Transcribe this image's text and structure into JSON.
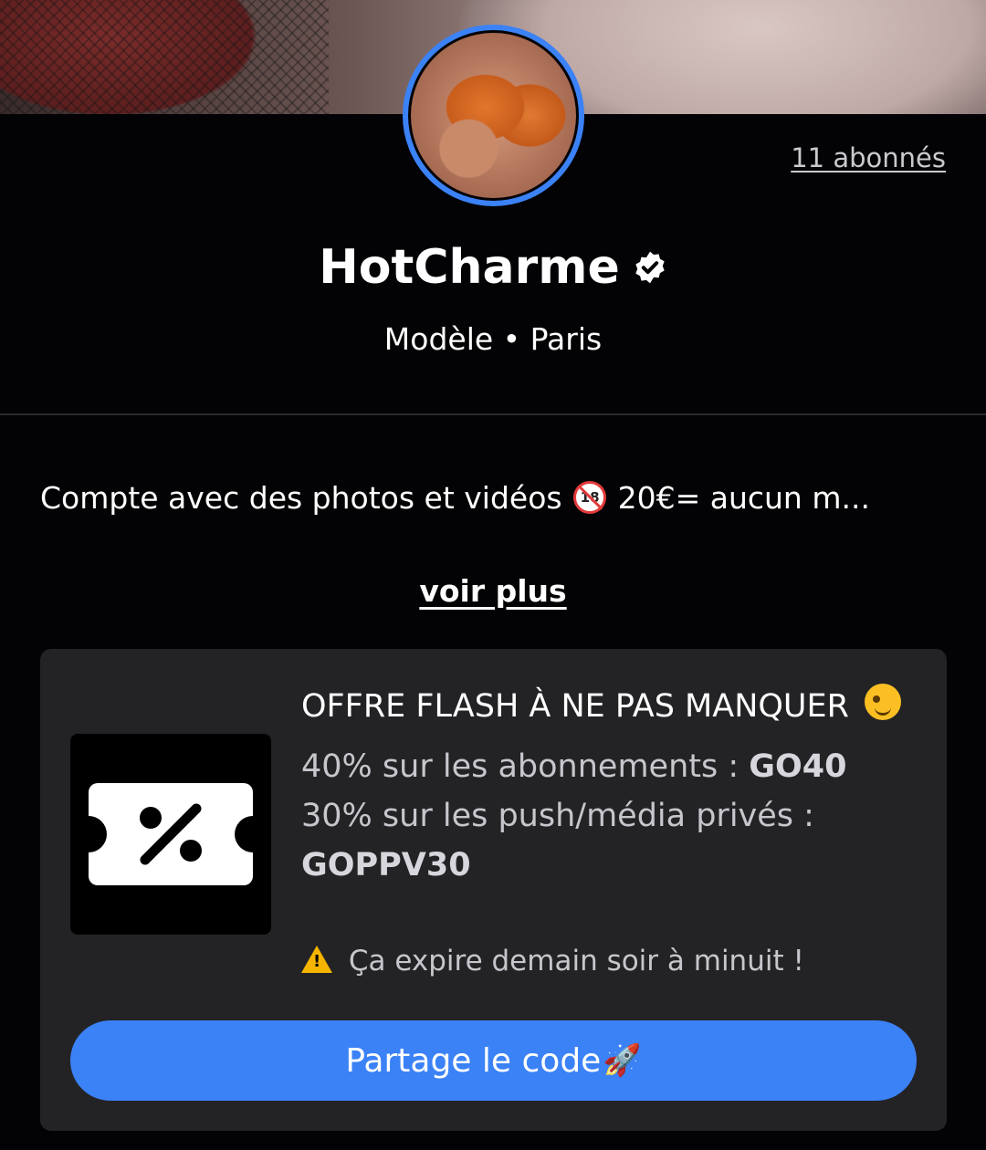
{
  "profile": {
    "followers_label": "11 abonnés",
    "name": "HotCharme",
    "subtitle": "Modèle • Paris",
    "bio_before": "Compte avec des photos et vidéos",
    "bio_after": "20€= aucun m...",
    "more_label": "voir plus"
  },
  "promo": {
    "title": "OFFRE FLASH À NE PAS MANQUER",
    "line1_text": "40% sur les abonnements : ",
    "line1_code": "GO40",
    "line2_text": "30% sur les push/média privés : ",
    "line2_code": "GOPPV30",
    "expire": "Ça expire demain soir à minuit !",
    "share_label": "Partage le code"
  },
  "colors": {
    "accent": "#3b82f6",
    "card_bg": "#232326",
    "page_bg": "#030305"
  },
  "icons": {
    "verified": "verified-badge-icon",
    "adult": "no-under-18-icon",
    "wink": "wink-emoji-icon",
    "coupon": "discount-ticket-icon",
    "warning": "warning-icon",
    "rocket": "rocket-icon"
  }
}
